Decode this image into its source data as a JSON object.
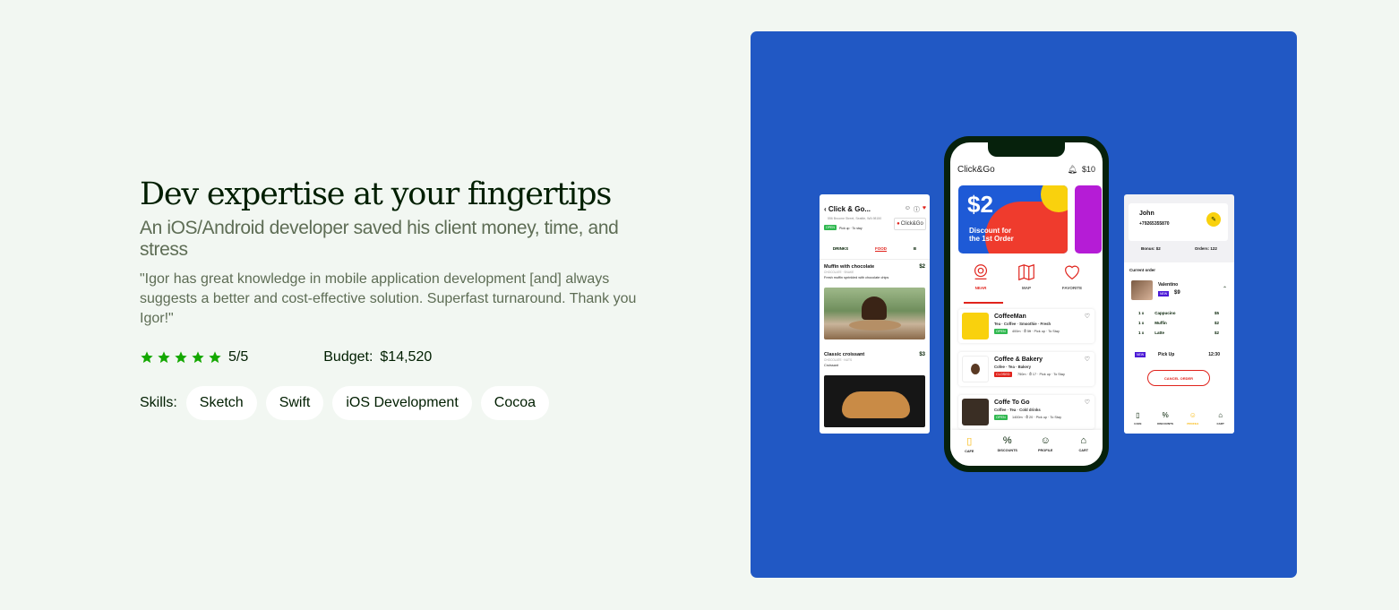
{
  "headline": "Dev expertise at your fingertips",
  "subhead": "An iOS/Android developer saved his client money, time, and stress",
  "quote": "\"Igor has great knowledge in mobile application development [and] always suggests a better and cost-effective solution. Superfast turnaround. Thank you Igor!\"",
  "rating": {
    "value": 5,
    "max": 5,
    "text": "5/5",
    "star_color": "#14a800"
  },
  "budget": {
    "label": "Budget:",
    "value": "$14,520"
  },
  "skills": {
    "label": "Skills:",
    "items": [
      "Sketch",
      "Swift",
      "iOS Development",
      "Cocoa"
    ]
  },
  "colors": {
    "background": "#f2f7f2",
    "panel": "#2158c4",
    "accent_red": "#e0231c"
  },
  "phone": {
    "logo": "Click&Go",
    "balance": "$10",
    "promo_big": "$2",
    "promo_line1": "Discount for",
    "promo_line2": "the 1st Order",
    "tabs": [
      {
        "label": "NEAR",
        "icon": "location-icon"
      },
      {
        "label": "MAP",
        "icon": "map-icon"
      },
      {
        "label": "FAVORITE",
        "icon": "heart-icon"
      }
    ],
    "places": [
      {
        "name": "CoffeeMan",
        "sub": "Tea · Coffee · Smoothie · Fresh",
        "badge": "OPEN",
        "badge_color": "#2fb84f",
        "info": "400m · ⏱ 5ft · Pick up · To Stay",
        "thumb": "#f9d10d"
      },
      {
        "name": "Coffee & Bakery",
        "sub": "Cofee · Tea · Bakery",
        "badge": "CLOSED",
        "badge_color": "#e0231c",
        "info": "750m · ⏱ 17 · Pick up · To Stay",
        "thumb": "#ffffff"
      },
      {
        "name": "Coffe To Go",
        "sub": "Coffee · Tea · Cold drinks",
        "badge": "OPEN",
        "badge_color": "#2fb84f",
        "info": "1400m · ⏱ 20 · Pick up · To Stay",
        "thumb": "#3a2e24"
      }
    ],
    "nav": [
      {
        "label": "CAFE",
        "icon": "cup-icon"
      },
      {
        "label": "DISCOUNTS",
        "icon": "percent-icon"
      },
      {
        "label": "PROFILE",
        "icon": "profile-icon"
      },
      {
        "label": "CART",
        "icon": "bag-icon"
      }
    ]
  },
  "left_card": {
    "title": "Click & Go...",
    "address": "556 Broome Street, Seattle, WA 98150",
    "badge": "OPEN",
    "pickup": "Pick up · To stay",
    "logo": "Click&Go",
    "tabs": [
      "DRINKS",
      "FOOD",
      "B"
    ],
    "items": [
      {
        "name": "Muffin with chocolate",
        "price": "$2",
        "cat": "CHOCOLATE · SNAKE",
        "desc": "Fresh muffin sprinkled with chocolate chips"
      },
      {
        "name": "Classic croissant",
        "price": "$3",
        "cat": "CHOCOLATE · NUTS",
        "desc": "Croissant"
      }
    ]
  },
  "right_card": {
    "name": "John",
    "phone": "+79265355870",
    "bonus": "Bonus: $2",
    "orders": "Orders: 122",
    "current_order": "Current order",
    "cafe": "Valentino",
    "new_badge": "NEW",
    "total": "$9",
    "lines": [
      {
        "qty": "1 x",
        "item": "Cappucino",
        "price": "$5"
      },
      {
        "qty": "1 x",
        "item": "Muffin",
        "price": "$2"
      },
      {
        "qty": "1 x",
        "item": "Latte",
        "price": "$2"
      }
    ],
    "pickup_badge": "NEW",
    "pickup": "Pick Up",
    "pickup_time": "12:30",
    "cancel": "CANCEL ORDER",
    "nav": [
      "CAFE",
      "DISCOUNTS",
      "PROFILE",
      "CART"
    ]
  }
}
